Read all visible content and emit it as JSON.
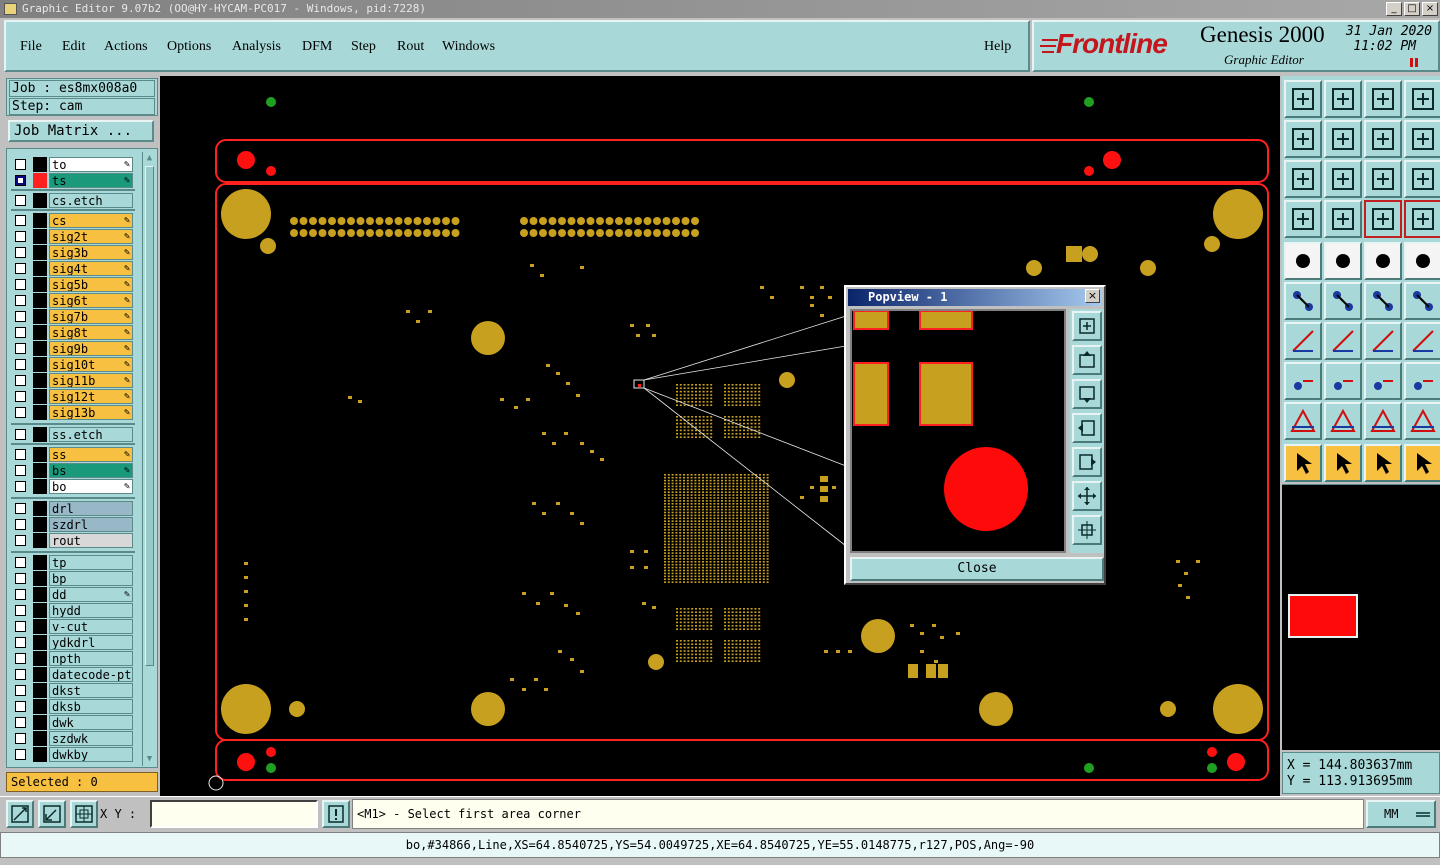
{
  "window": {
    "title": "Graphic Editor 9.07b2 (OO@HY-HYCAM-PC017 - Windows, pid:7228)",
    "minimize": "_",
    "maximize": "□",
    "close": "×"
  },
  "menu": {
    "items": [
      "File",
      "Edit",
      "Actions",
      "Options",
      "Analysis",
      "DFM",
      "Step",
      "Rout",
      "Windows"
    ],
    "help": "Help"
  },
  "brand": {
    "logo": "Frontline",
    "product": "Genesis 2000",
    "subtitle": "Graphic Editor",
    "date": "31 Jan 2020",
    "time": "11:02 PM"
  },
  "job": {
    "job_line": "Job : es8mx008a0",
    "step_line": "Step: cam",
    "matrix_button": "Job Matrix ..."
  },
  "layers": [
    {
      "name": "to",
      "color": "#ffffff",
      "edit": true,
      "checked": false,
      "swatch": "#000000"
    },
    {
      "name": "ts",
      "color": "#1a9a7a",
      "edit": true,
      "checked": true,
      "swatch": "#ff2020"
    },
    {
      "name": "cs.etch",
      "color": "#a8d8d8",
      "edit": false,
      "checked": false,
      "swatch": "#000000"
    },
    {
      "name": "cs",
      "color": "#f8c040",
      "edit": true,
      "checked": false,
      "swatch": "#000000"
    },
    {
      "name": "sig2t",
      "color": "#f8c040",
      "edit": true,
      "checked": false,
      "swatch": "#000000"
    },
    {
      "name": "sig3b",
      "color": "#f8c040",
      "edit": true,
      "checked": false,
      "swatch": "#000000"
    },
    {
      "name": "sig4t",
      "color": "#f8c040",
      "edit": true,
      "checked": false,
      "swatch": "#000000"
    },
    {
      "name": "sig5b",
      "color": "#f8c040",
      "edit": true,
      "checked": false,
      "swatch": "#000000"
    },
    {
      "name": "sig6t",
      "color": "#f8c040",
      "edit": true,
      "checked": false,
      "swatch": "#000000"
    },
    {
      "name": "sig7b",
      "color": "#f8c040",
      "edit": true,
      "checked": false,
      "swatch": "#000000"
    },
    {
      "name": "sig8t",
      "color": "#f8c040",
      "edit": true,
      "checked": false,
      "swatch": "#000000"
    },
    {
      "name": "sig9b",
      "color": "#f8c040",
      "edit": true,
      "checked": false,
      "swatch": "#000000"
    },
    {
      "name": "sig10t",
      "color": "#f8c040",
      "edit": true,
      "checked": false,
      "swatch": "#000000"
    },
    {
      "name": "sig11b",
      "color": "#f8c040",
      "edit": true,
      "checked": false,
      "swatch": "#000000"
    },
    {
      "name": "sig12t",
      "color": "#f8c040",
      "edit": true,
      "checked": false,
      "swatch": "#000000"
    },
    {
      "name": "sig13b",
      "color": "#f8c040",
      "edit": true,
      "checked": false,
      "swatch": "#000000"
    },
    {
      "name": "ss.etch",
      "color": "#a8d8d8",
      "edit": false,
      "checked": false,
      "swatch": "#000000"
    },
    {
      "name": "ss",
      "color": "#f8c040",
      "edit": true,
      "checked": false,
      "swatch": "#000000"
    },
    {
      "name": "bs",
      "color": "#1a9a7a",
      "edit": true,
      "checked": false,
      "swatch": "#000000"
    },
    {
      "name": "bo",
      "color": "#ffffff",
      "edit": true,
      "checked": false,
      "swatch": "#000000"
    },
    {
      "name": "drl",
      "color": "#98b8c8",
      "edit": false,
      "checked": false,
      "swatch": "#000000"
    },
    {
      "name": "szdrl",
      "color": "#98b8c8",
      "edit": false,
      "checked": false,
      "swatch": "#000000"
    },
    {
      "name": "rout",
      "color": "#d8d8d8",
      "edit": false,
      "checked": false,
      "swatch": "#000000"
    },
    {
      "name": "tp",
      "color": "#a8d8d8",
      "edit": false,
      "checked": false,
      "swatch": "#000000"
    },
    {
      "name": "bp",
      "color": "#a8d8d8",
      "edit": false,
      "checked": false,
      "swatch": "#000000"
    },
    {
      "name": "dd",
      "color": "#a8d8d8",
      "edit": true,
      "checked": false,
      "swatch": "#000000"
    },
    {
      "name": "hydd",
      "color": "#a8d8d8",
      "edit": false,
      "checked": false,
      "swatch": "#000000"
    },
    {
      "name": "v-cut",
      "color": "#a8d8d8",
      "edit": false,
      "checked": false,
      "swatch": "#000000"
    },
    {
      "name": "ydkdrl",
      "color": "#a8d8d8",
      "edit": false,
      "checked": false,
      "swatch": "#000000"
    },
    {
      "name": "npth",
      "color": "#a8d8d8",
      "edit": false,
      "checked": false,
      "swatch": "#000000"
    },
    {
      "name": "datecode-pte",
      "color": "#a8d8d8",
      "edit": false,
      "checked": false,
      "swatch": "#000000"
    },
    {
      "name": "dkst",
      "color": "#a8d8d8",
      "edit": false,
      "checked": false,
      "swatch": "#000000"
    },
    {
      "name": "dksb",
      "color": "#a8d8d8",
      "edit": false,
      "checked": false,
      "swatch": "#000000"
    },
    {
      "name": "dwk",
      "color": "#a8d8d8",
      "edit": false,
      "checked": false,
      "swatch": "#000000"
    },
    {
      "name": "szdwk",
      "color": "#a8d8d8",
      "edit": false,
      "checked": false,
      "swatch": "#000000"
    },
    {
      "name": "dwkby",
      "color": "#a8d8d8",
      "edit": false,
      "checked": false,
      "swatch": "#000000"
    }
  ],
  "selected": "Selected : 0",
  "popview": {
    "title": "Popview - 1",
    "close_button": "Close"
  },
  "coords": {
    "x": "X = 144.803637mm",
    "y": "Y = 113.913695mm"
  },
  "bottom": {
    "xy_label": "X Y :",
    "xy_value": "",
    "prompt": "<M1> - Select first area corner",
    "units": "MM",
    "status": "bo,#34866,Line,XS=64.8540725,YS=54.0049725,XE=64.8540725,YE=55.0148775,r127,POS,Ang=-90"
  },
  "colors": {
    "menu_bg": "#a8d8d8",
    "pad": "#c8a020",
    "board_outline": "#ff2020",
    "highlight": "#f8c040",
    "active_layer": "#1a9a7a"
  }
}
